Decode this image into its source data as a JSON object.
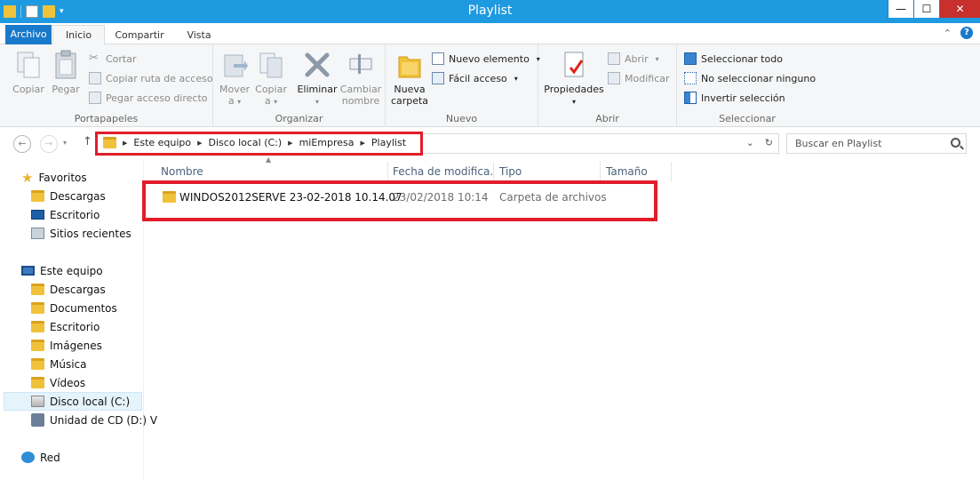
{
  "window": {
    "title": "Playlist",
    "minimize": "—",
    "maximize": "☐",
    "close": "✕"
  },
  "tabs": {
    "file": "Archivo",
    "home": "Inicio",
    "share": "Compartir",
    "view": "Vista",
    "help": "?"
  },
  "ribbon": {
    "portapapeles": {
      "label": "Portapapeles",
      "copy": "Copiar",
      "paste": "Pegar",
      "cut": "Cortar",
      "copy_path": "Copiar ruta de acceso",
      "paste_shortcut": "Pegar acceso directo"
    },
    "organizar": {
      "label": "Organizar",
      "move_line1": "Mover",
      "move_line2": "a",
      "copyto_line1": "Copiar",
      "copyto_line2": "a",
      "delete": "Eliminar",
      "rename_line1": "Cambiar",
      "rename_line2": "nombre"
    },
    "nuevo": {
      "label": "Nuevo",
      "new_folder_line1": "Nueva",
      "new_folder_line2": "carpeta",
      "new_item": "Nuevo elemento",
      "easy_access": "Fácil acceso"
    },
    "abrir": {
      "label": "Abrir",
      "properties": "Propiedades",
      "open": "Abrir",
      "edit": "Modificar"
    },
    "seleccionar": {
      "label": "Seleccionar",
      "select_all": "Seleccionar todo",
      "select_none": "No seleccionar ninguno",
      "invert": "Invertir selección"
    }
  },
  "address": {
    "crumbs": [
      "Este equipo",
      "Disco local (C:)",
      "miEmpresa",
      "Playlist"
    ],
    "search_placeholder": "Buscar en Playlist"
  },
  "nav": {
    "favorites": "Favoritos",
    "fav_items": [
      "Descargas",
      "Escritorio",
      "Sitios recientes"
    ],
    "this_pc": "Este equipo",
    "pc_items": [
      "Descargas",
      "Documentos",
      "Escritorio",
      "Imágenes",
      "Música",
      "Vídeos",
      "Disco local (C:)",
      "Unidad de CD (D:) V"
    ],
    "network": "Red"
  },
  "columns": {
    "name": "Nombre",
    "date": "Fecha de modifica...",
    "type": "Tipo",
    "size": "Tamaño"
  },
  "files": [
    {
      "name": "WINDOS2012SERVE 23-02-2018 10.14.07",
      "date": "23/02/2018 10:14",
      "type": "Carpeta de archivos",
      "size": ""
    }
  ],
  "colors": {
    "titlebar": "#1e9ae0",
    "file_tab": "#1979ca",
    "highlight": "#e21d2a",
    "selection": "#e5f3fb"
  }
}
